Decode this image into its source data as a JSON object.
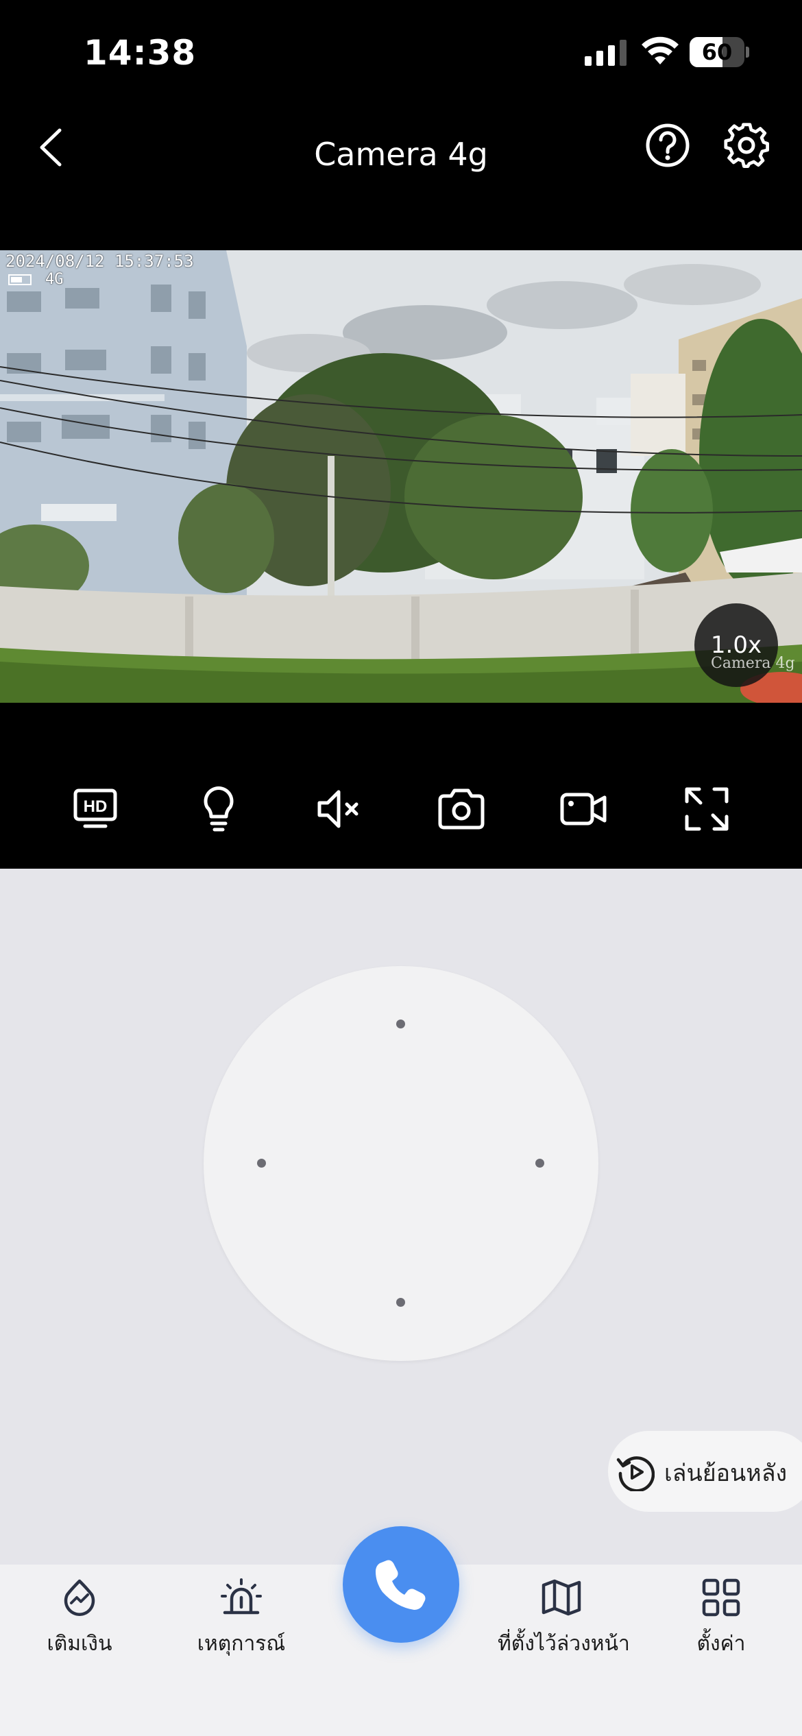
{
  "status_bar": {
    "time": "14:38",
    "battery_percent": "60",
    "battery_level": 0.6,
    "signal_icon": "cellular-signal-icon",
    "wifi_icon": "wifi-icon"
  },
  "header": {
    "title": "Camera 4g",
    "back_icon": "chevron-left-icon",
    "help_icon": "question-circle-icon",
    "settings_icon": "gear-icon"
  },
  "video": {
    "osd_timestamp": "2024/08/12 15:37:53",
    "osd_network": "4G",
    "zoom": "1.0x",
    "watermark": "Camera 4g"
  },
  "toolbar": {
    "items": [
      {
        "name": "hd-quality-button",
        "icon": "hd-icon"
      },
      {
        "name": "light-button",
        "icon": "lightbulb-icon"
      },
      {
        "name": "mute-button",
        "icon": "speaker-muted-icon"
      },
      {
        "name": "snapshot-button",
        "icon": "camera-icon"
      },
      {
        "name": "record-button",
        "icon": "video-camera-icon"
      },
      {
        "name": "fullscreen-button",
        "icon": "expand-icon"
      }
    ]
  },
  "ptz": {
    "playback_label": "เล่นย้อนหลัง",
    "playback_icon": "replay-icon"
  },
  "tabbar": {
    "items": [
      {
        "label": "เติมเงิน",
        "icon": "topup-icon"
      },
      {
        "label": "เหตุการณ์",
        "icon": "siren-icon"
      },
      {
        "label": "ที่ตั้งไว้ล่วงหน้า",
        "icon": "map-icon"
      },
      {
        "label": "ตั้งค่า",
        "icon": "grid-icon"
      }
    ],
    "call_icon": "phone-icon"
  },
  "colors": {
    "accent": "#4a8ef0",
    "panel_bg": "#e5e5ea",
    "joystick_bg": "#f2f2f3"
  }
}
